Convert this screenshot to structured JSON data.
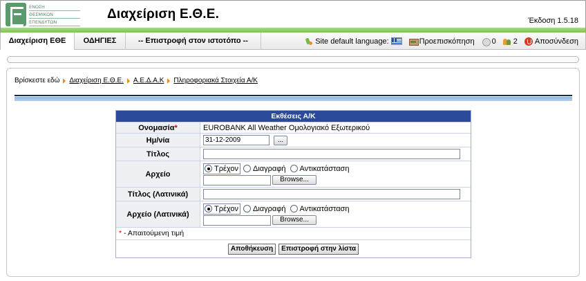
{
  "header": {
    "logo_lines": [
      "ΕΝΩΣΗ",
      "ΘΕΣΜΙΚΩΝ",
      "ΕΠΕΝΔΥΤΩΝ"
    ],
    "app_title": "Διαχείριση Ε.Θ.Ε.",
    "version": "Έκδοση 1.5.18"
  },
  "menu": {
    "items": [
      {
        "label": "Διαχείριση ΕΘΕ"
      },
      {
        "label": "ΟΔΗΓΙΕΣ"
      },
      {
        "label": "-- Επιστροφή στον ιστοτόπο --"
      }
    ],
    "site_default_language": "Site default language:",
    "preview": "Προεπισκόπηση",
    "messages_count": "0",
    "users_count": "2",
    "logout": "Αποσύνδεση"
  },
  "breadcrumb": {
    "prefix": "Βρίσκεστε εδώ",
    "items": [
      "Διαχείριση Ε.Θ.Ε.",
      "Α.Ε.Δ.Α.Κ",
      "Πληροφοριακά Στοιχεία Α/Κ"
    ]
  },
  "form": {
    "title": "Εκθέσεις Α/Κ",
    "name_label": "Ονομασία",
    "name_value": "EUROBANK All Weather Ομολογιακό Εξωτερικού",
    "date_label": "Ημ/νία",
    "date_value": "31-12-2009",
    "date_button": "...",
    "title_label": "Τίτλος",
    "title_value": "",
    "file_label": "Αρχείο",
    "title_latin_label": "Τίτλος (Λατινικά)",
    "title_latin_value": "",
    "file_latin_label": "Αρχείο (Λατινικά)",
    "radio_current": "Τρέχον",
    "radio_delete": "Διαγραφή",
    "radio_replace": "Αντικατάσταση",
    "browse": "Browse...",
    "required_marker": "*",
    "required_note": " - Απαιτούμενη τιμή",
    "save_button": "Αποθήκευση",
    "back_button": "Επιστροφή στην λίστα"
  }
}
